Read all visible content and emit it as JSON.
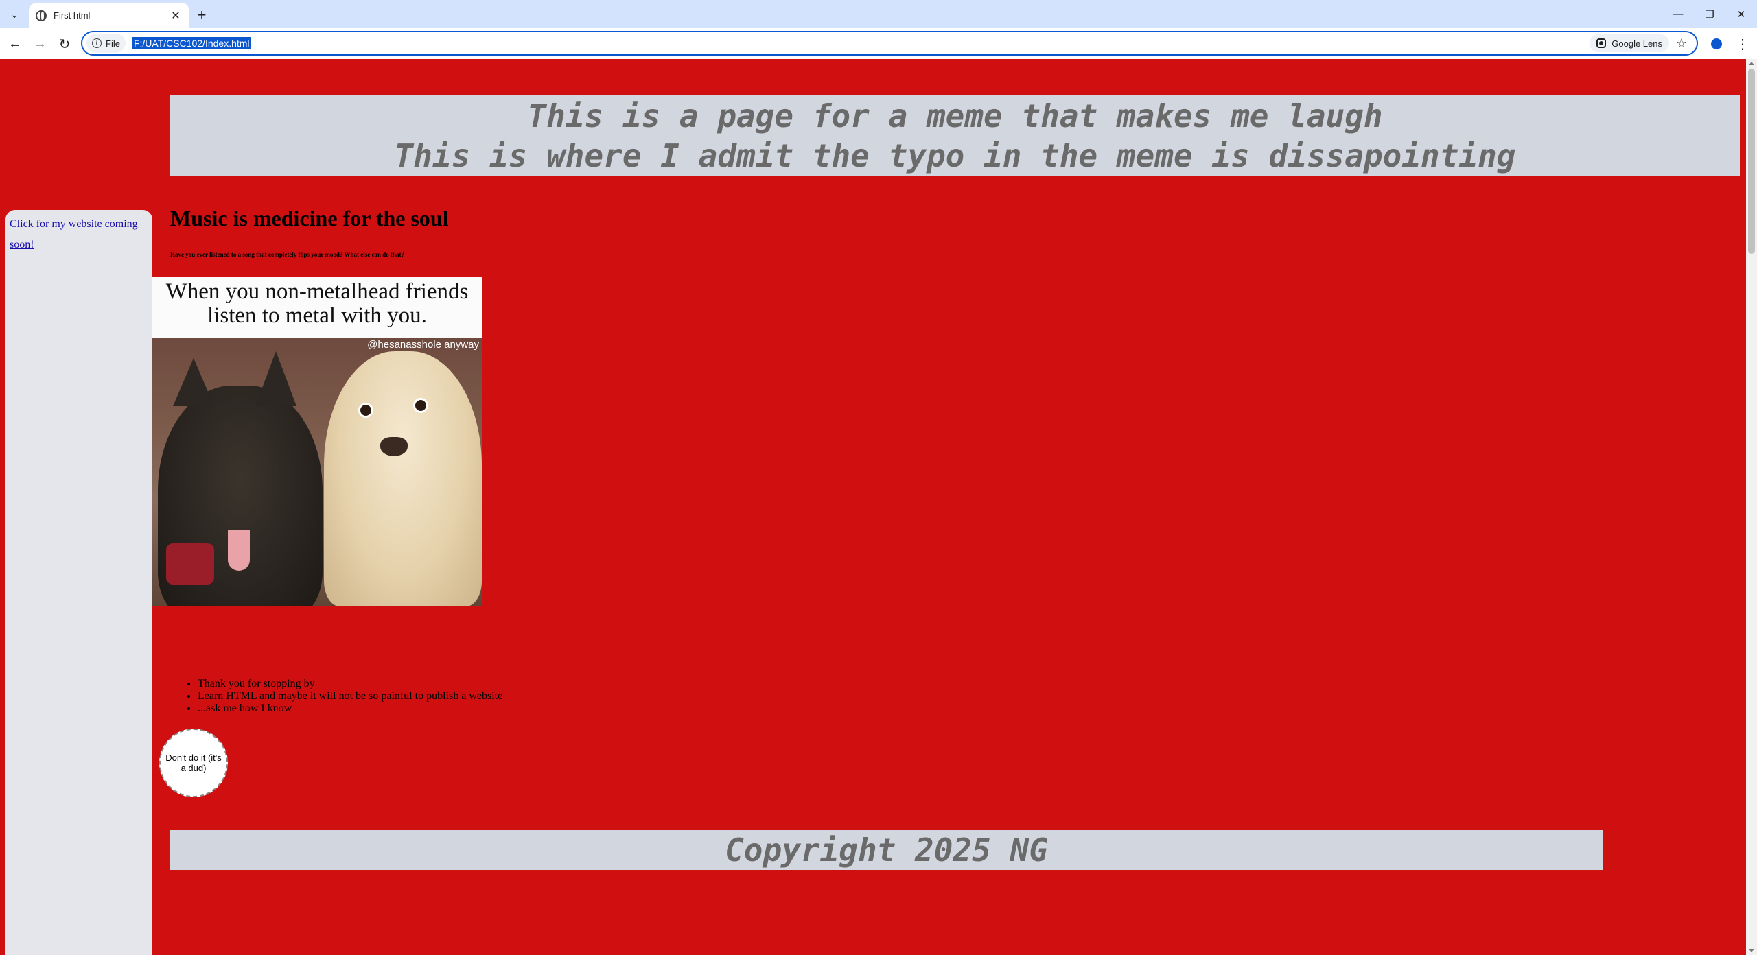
{
  "browser": {
    "tab_title": "First html",
    "new_tab": "+",
    "site_info_label": "File",
    "url": "F:/UAT/CSC102/Index.html",
    "lens_label": "Google Lens"
  },
  "page": {
    "header_line1": "This is a page for a meme that makes me laugh",
    "header_line2": "This is where I admit the typo in the meme is dissapointing",
    "sidebar_link": "Click for my website coming soon!",
    "heading": "Music is medicine for the soul",
    "subtitle": "Have you ever listened to a song that completely flips your mood? What else can do that?",
    "meme_caption": "When you non-metalhead friends listen to metal with you.",
    "meme_credit": "@hesanasshole anyway",
    "list_items": [
      "Thank you for stopping by",
      "Learn HTML and maybe it will not be so painful to publish a website",
      "...ask me how I know"
    ],
    "dud_button": "Don't do it (it's a dud)",
    "footer": "Copyright 2025 NG"
  },
  "icons": {
    "tab_list": "chevron-down-icon",
    "close": "close-icon",
    "back": "back-arrow-icon",
    "forward": "forward-arrow-icon",
    "reload": "reload-icon",
    "info": "info-icon",
    "lens": "google-lens-icon",
    "star": "star-icon",
    "profile": "profile-icon",
    "menu": "kebab-menu-icon"
  },
  "colors": {
    "page_background": "#d01010",
    "box_background": "#d2d6df",
    "accent": "#0b57d0"
  }
}
